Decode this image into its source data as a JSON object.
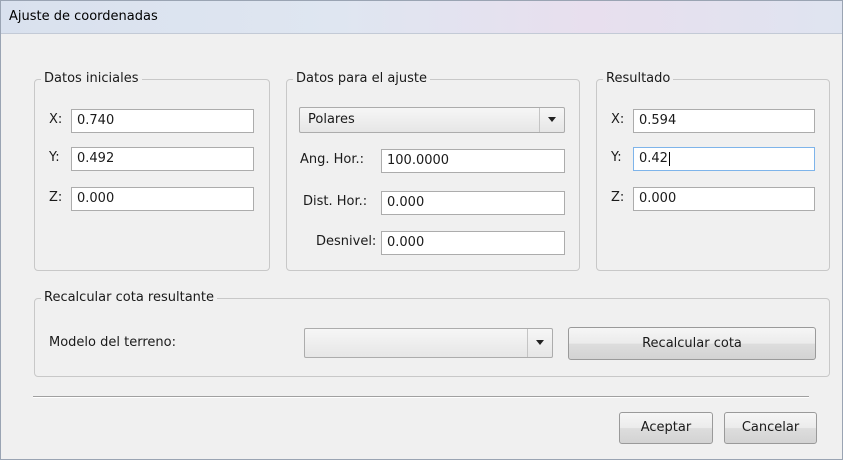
{
  "window": {
    "title": "Ajuste de coordenadas"
  },
  "datos_iniciales": {
    "legend": "Datos iniciales",
    "x_label": "X:",
    "x_value": "0.740",
    "y_label": "Y:",
    "y_value": "0.492",
    "z_label": "Z:",
    "z_value": "0.000"
  },
  "datos_ajuste": {
    "legend": "Datos para el ajuste",
    "mode_selected": "Polares",
    "ang_label": "Ang. Hor.:",
    "ang_value": "100.0000",
    "dist_label": "Dist. Hor.:",
    "dist_value": "0.000",
    "desnivel_label": "Desnivel:",
    "desnivel_value": "0.000"
  },
  "resultado": {
    "legend": "Resultado",
    "x_label": "X:",
    "x_value": "0.594",
    "y_label": "Y:",
    "y_value": "0.42",
    "z_label": "Z:",
    "z_value": "0.000"
  },
  "recalcular": {
    "legend": "Recalcular cota resultante",
    "modelo_label": "Modelo del terreno:",
    "modelo_selected": "",
    "button_label": "Recalcular cota"
  },
  "footer": {
    "accept_label": "Aceptar",
    "cancel_label": "Cancelar"
  },
  "icons": {
    "dropdown": "chevron-down-icon"
  }
}
